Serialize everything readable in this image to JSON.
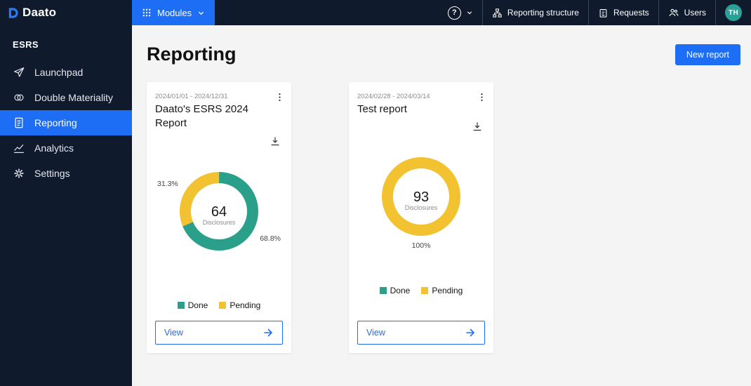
{
  "topbar": {
    "logo_text": "Daato",
    "modules_label": "Modules",
    "help_label": "?",
    "nav_items": [
      {
        "label": "Reporting structure",
        "icon": "structure-icon"
      },
      {
        "label": "Requests",
        "icon": "requests-icon"
      },
      {
        "label": "Users",
        "icon": "users-icon"
      }
    ],
    "avatar_initials": "TH"
  },
  "sidebar": {
    "section_label": "ESRS",
    "items": [
      {
        "label": "Launchpad",
        "icon": "rocket-icon",
        "active": false
      },
      {
        "label": "Double Materiality",
        "icon": "overlapping-circles-icon",
        "active": false
      },
      {
        "label": "Reporting",
        "icon": "document-icon",
        "active": true
      },
      {
        "label": "Analytics",
        "icon": "line-chart-icon",
        "active": false
      },
      {
        "label": "Settings",
        "icon": "gear-icon",
        "active": false
      }
    ]
  },
  "main": {
    "title": "Reporting",
    "new_report_label": "New report",
    "cards": [
      {
        "date_range": "2024/01/01 - 2024/12/31",
        "title": "Daato's ESRS 2024 Report",
        "view_label": "View"
      },
      {
        "date_range": "2024/02/28 - 2024/03/14",
        "title": "Test report",
        "view_label": "View"
      }
    ]
  },
  "colors": {
    "accent_blue": "#1e6ef5",
    "done_teal": "#2aa08a",
    "pending_yellow": "#f2c230",
    "navy": "#0f1b2d",
    "avatar_teal": "#2aa196"
  },
  "chart_data": [
    {
      "type": "pie",
      "title": "Daato's ESRS 2024 Report",
      "center_value": "64",
      "center_label": "Disclosures",
      "series": [
        {
          "name": "Done",
          "pct": 68.8,
          "pct_label": "68.8%",
          "color": "#2aa08a"
        },
        {
          "name": "Pending",
          "pct": 31.3,
          "pct_label": "31.3%",
          "color": "#f2c230"
        }
      ],
      "legend": [
        "Done",
        "Pending"
      ],
      "legend_position": "bottom"
    },
    {
      "type": "pie",
      "title": "Test report",
      "center_value": "93",
      "center_label": "Disclosures",
      "series": [
        {
          "name": "Done",
          "pct": 0,
          "pct_label": "",
          "color": "#2aa08a"
        },
        {
          "name": "Pending",
          "pct": 100,
          "pct_label": "100%",
          "color": "#f2c230"
        }
      ],
      "legend": [
        "Done",
        "Pending"
      ],
      "legend_position": "bottom"
    }
  ]
}
